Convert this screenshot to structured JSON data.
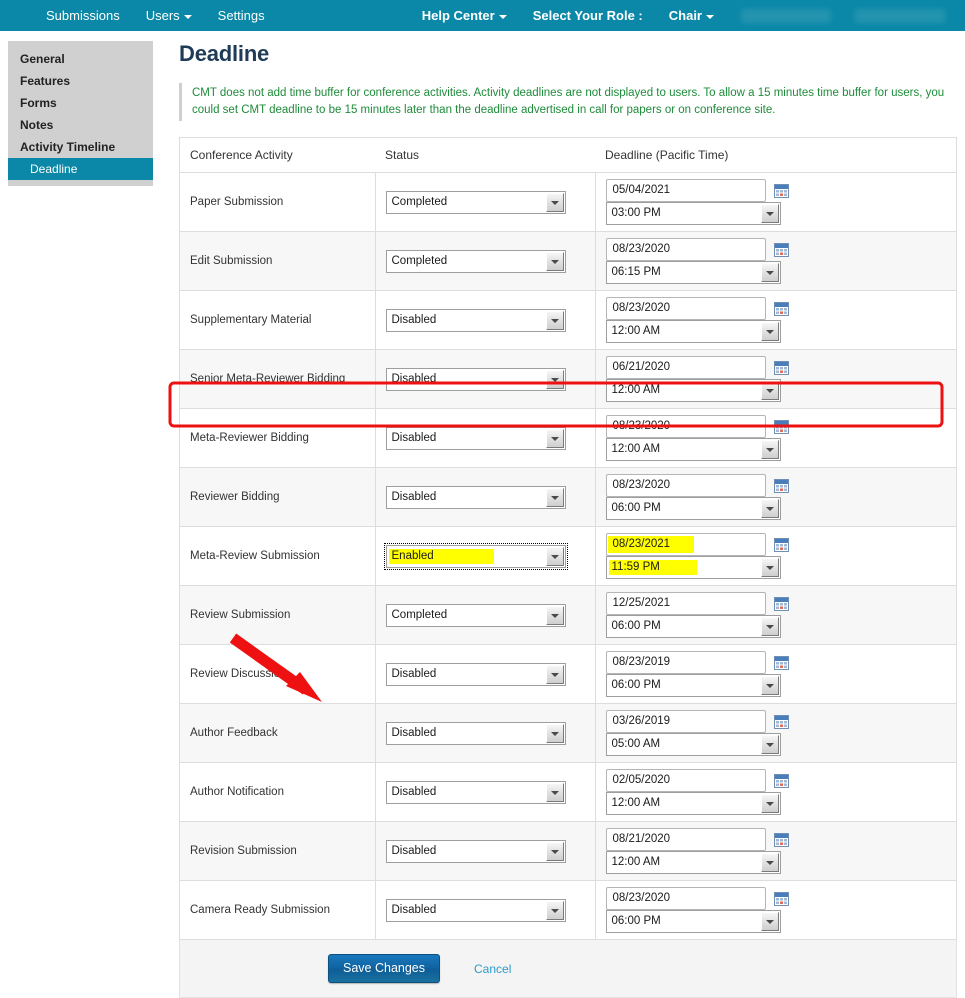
{
  "navbar": {
    "background": "#0b88a7",
    "left_items": [
      {
        "label": "Submissions",
        "caret": false
      },
      {
        "label": "Users",
        "caret": true
      },
      {
        "label": "Settings",
        "caret": false
      }
    ],
    "right_items": [
      {
        "label": "Help Center",
        "caret": true,
        "bold": true
      },
      {
        "label": "Select Your Role :",
        "caret": false,
        "bold": true
      },
      {
        "label": "Chair",
        "caret": true,
        "bold": true
      }
    ],
    "redacted_blocks": 2
  },
  "sidebar": {
    "items": [
      {
        "label": "General",
        "active": false
      },
      {
        "label": "Features",
        "active": false
      },
      {
        "label": "Forms",
        "active": false
      },
      {
        "label": "Notes",
        "active": false
      },
      {
        "label": "Activity Timeline",
        "active": false
      },
      {
        "label": "Deadline",
        "active": true
      }
    ],
    "active_color": "#0b88a7"
  },
  "main": {
    "page_title": "Deadline",
    "info_banner": "CMT does not add time buffer for conference activities. Activity deadlines are not displayed to users. To allow a 15 minutes time buffer for users, you could set CMT deadline to be 15 minutes later than the deadline advertised in call for papers or on conference site.",
    "info_banner_color": "#1e8c3a",
    "table": {
      "columns": [
        "Conference Activity",
        "Status",
        "Deadline (Pacific Time)"
      ],
      "rows": [
        {
          "activity": "Paper Submission",
          "status": "Completed",
          "date": "05/04/2021",
          "time": "03:00 PM",
          "highlighted": false
        },
        {
          "activity": "Edit Submission",
          "status": "Completed",
          "date": "08/23/2020",
          "time": "06:15 PM",
          "highlighted": false
        },
        {
          "activity": "Supplementary Material",
          "status": "Disabled",
          "date": "08/23/2020",
          "time": "12:00 AM",
          "highlighted": false
        },
        {
          "activity": "Senior Meta-Reviewer Bidding",
          "status": "Disabled",
          "date": "06/21/2020",
          "time": "12:00 AM",
          "highlighted": false
        },
        {
          "activity": "Meta-Reviewer Bidding",
          "status": "Disabled",
          "date": "08/23/2020",
          "time": "12:00 AM",
          "highlighted": false
        },
        {
          "activity": "Reviewer Bidding",
          "status": "Disabled",
          "date": "08/23/2020",
          "time": "06:00 PM",
          "highlighted": false
        },
        {
          "activity": "Meta-Review Submission",
          "status": "Enabled",
          "date": "08/23/2021",
          "time": "11:59 PM",
          "highlighted": true
        },
        {
          "activity": "Review Submission",
          "status": "Completed",
          "date": "12/25/2021",
          "time": "06:00 PM",
          "highlighted": false
        },
        {
          "activity": "Review Discussion",
          "status": "Disabled",
          "date": "08/23/2019",
          "time": "06:00 PM",
          "highlighted": false
        },
        {
          "activity": "Author Feedback",
          "status": "Disabled",
          "date": "03/26/2019",
          "time": "05:00 AM",
          "highlighted": false
        },
        {
          "activity": "Author Notification",
          "status": "Disabled",
          "date": "02/05/2020",
          "time": "12:00 AM",
          "highlighted": false
        },
        {
          "activity": "Revision Submission",
          "status": "Disabled",
          "date": "08/21/2020",
          "time": "12:00 AM",
          "highlighted": false
        },
        {
          "activity": "Camera Ready Submission",
          "status": "Disabled",
          "date": "08/23/2020",
          "time": "06:00 PM",
          "highlighted": false
        }
      ]
    },
    "footer": {
      "save_label": "Save Changes",
      "cancel_label": "Cancel"
    }
  },
  "annotations": {
    "highlight_color": "#ffff00",
    "callout_color": "#ee1111",
    "row_outline_row_index": 6,
    "arrow_points_to": "save-changes-button"
  },
  "icons": {
    "calendar": "calendar-icon",
    "dropdown": "chevron-down-icon"
  }
}
